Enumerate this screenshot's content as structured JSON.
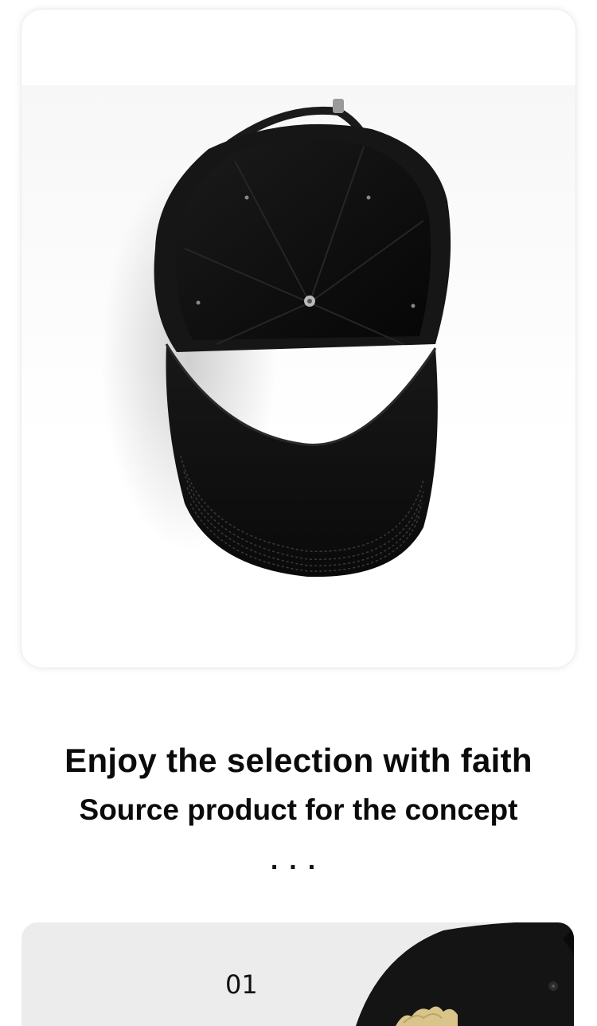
{
  "headline": "Enjoy the selection with faith",
  "subline": "Source product for the concept",
  "dots": "...",
  "bottom_card": {
    "number": "01"
  },
  "colors": {
    "cap": "#121212",
    "card_bg": "#ececec",
    "embroidery": "#d9c58a"
  },
  "icons": {
    "cap_underside_photo": "baseball-cap-image",
    "cap_front_photo": "baseball-cap-image"
  }
}
